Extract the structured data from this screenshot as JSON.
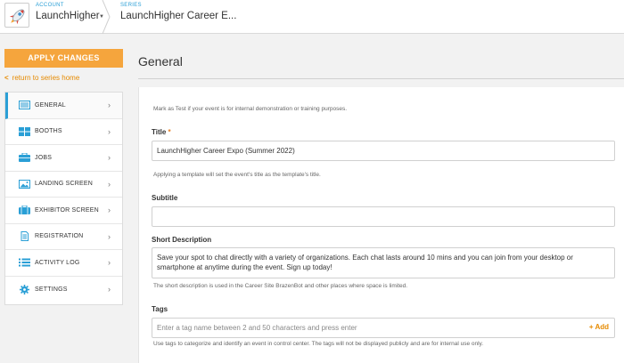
{
  "topbar": {
    "account_label": "ACCOUNT",
    "account_name": "LaunchHigher",
    "series_label": "SERIES",
    "series_name": "LaunchHigher Career E..."
  },
  "sidebar": {
    "apply_label": "APPLY CHANGES",
    "return_label": "return to series home",
    "items": [
      {
        "label": "GENERAL",
        "icon": "list-icon",
        "active": true
      },
      {
        "label": "BOOTHS",
        "icon": "grid-icon"
      },
      {
        "label": "JOBS",
        "icon": "briefcase-icon"
      },
      {
        "label": "LANDING SCREEN",
        "icon": "image-icon"
      },
      {
        "label": "EXHIBITOR SCREEN",
        "icon": "suitcase-icon"
      },
      {
        "label": "REGISTRATION",
        "icon": "document-icon"
      },
      {
        "label": "ACTIVITY LOG",
        "icon": "list-bullets-icon"
      },
      {
        "label": "SETTINGS",
        "icon": "gear-icon"
      }
    ]
  },
  "main": {
    "title": "General",
    "test_help": "Mark as Test if your event is for internal demonstration or training purposes.",
    "title_label": "Title",
    "title_required": "*",
    "title_value": "LaunchHigher Career Expo (Summer 2022)",
    "title_help": "Applying a template will set the event's title as the template's title.",
    "subtitle_label": "Subtitle",
    "subtitle_value": "",
    "short_desc_label": "Short Description",
    "short_desc_value": "Save your spot to chat directly with a variety of organizations. Each chat lasts around 10 mins and you can join from your desktop or smartphone at anytime during the event. Sign up today!",
    "short_desc_help": "The short description is used in the Career Site BrazenBot and other places where space is limited.",
    "tags_label": "Tags",
    "tags_placeholder": "Enter a tag name between 2 and 50 characters and press enter",
    "tags_add": "+ Add",
    "tags_help": "Use tags to categorize and identify an event in control center. The tags will not be displayed publicly and are for internal use only."
  },
  "colors": {
    "accent_blue": "#2a9fd6",
    "apply_orange": "#f5a53d",
    "link_orange": "#e68a00"
  }
}
